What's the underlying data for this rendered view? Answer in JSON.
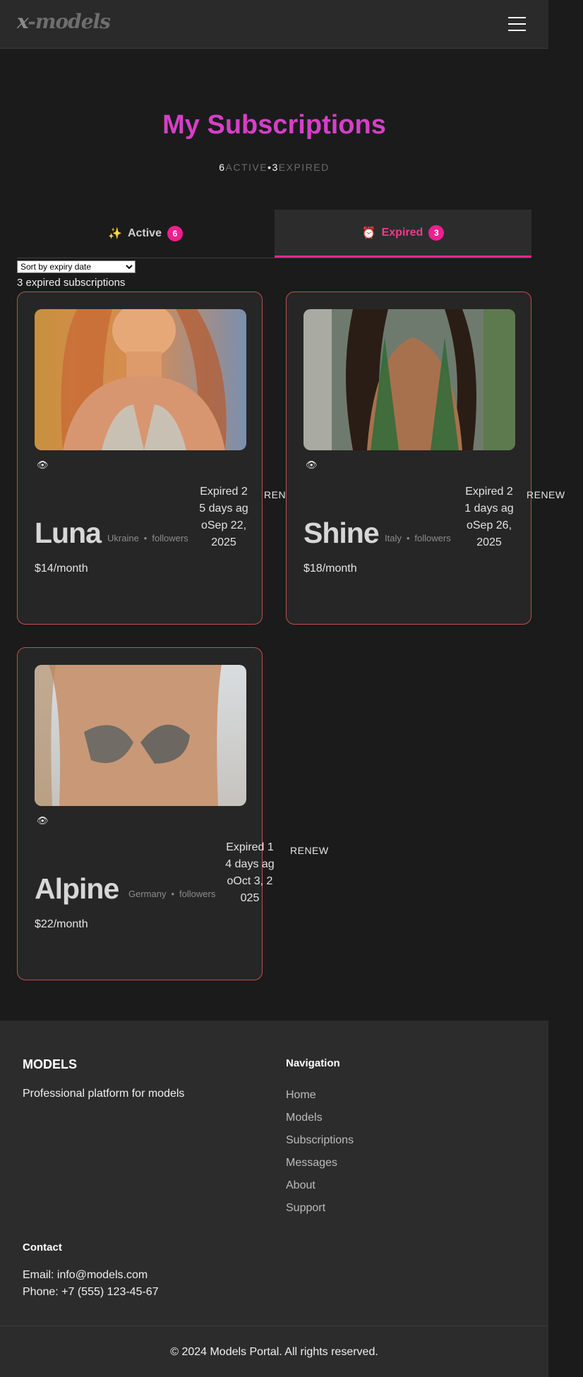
{
  "header": {
    "logo": "x-models",
    "logo_x": "x",
    "logo_rest": "-models"
  },
  "page": {
    "title": "My Subscriptions",
    "stats": {
      "active_count": "6",
      "active_label": "ACTIVE",
      "separator": "•",
      "expired_count": "3",
      "expired_label": "EXPIRED"
    }
  },
  "tabs": [
    {
      "icon": "✨",
      "label": "Active",
      "count": "6"
    },
    {
      "icon": "⏰",
      "label": "Expired",
      "count": "3"
    }
  ],
  "sort": {
    "selected": "Sort by expiry date"
  },
  "list": {
    "count_text": "3 expired subscriptions"
  },
  "cards": [
    {
      "name": "Luna",
      "country": "Ukraine",
      "followers": "followers",
      "price": "$14/month",
      "status": "Expired 25 days agoSep 22, 2025",
      "renew": "RENEW",
      "eye": "👁"
    },
    {
      "name": "Shine",
      "country": "Italy",
      "followers": "followers",
      "price": "$18/month",
      "status": "Expired 21 days agoSep 26, 2025",
      "renew": "RENEW",
      "eye": "👁"
    },
    {
      "name": "Alpine",
      "country": "Germany",
      "followers": "followers",
      "price": "$22/month",
      "status": "Expired 14 days agoOct 3, 2025",
      "renew": "RENEW",
      "eye": "👁"
    }
  ],
  "footer": {
    "brand": "MODELS",
    "tagline": "Professional platform for models",
    "nav_title": "Navigation",
    "nav": [
      "Home",
      "Models",
      "Subscriptions",
      "Messages",
      "About",
      "Support"
    ],
    "contact_title": "Contact",
    "email": "Email: info@models.com",
    "phone": "Phone: +7 (555) 123-45-67",
    "copyright": "© 2024 Models Portal. All rights reserved."
  },
  "colors": {
    "accent": "#e3298e",
    "title": "#d63fc7",
    "card_border": "#c0504f",
    "background": "#1b1b1b"
  }
}
